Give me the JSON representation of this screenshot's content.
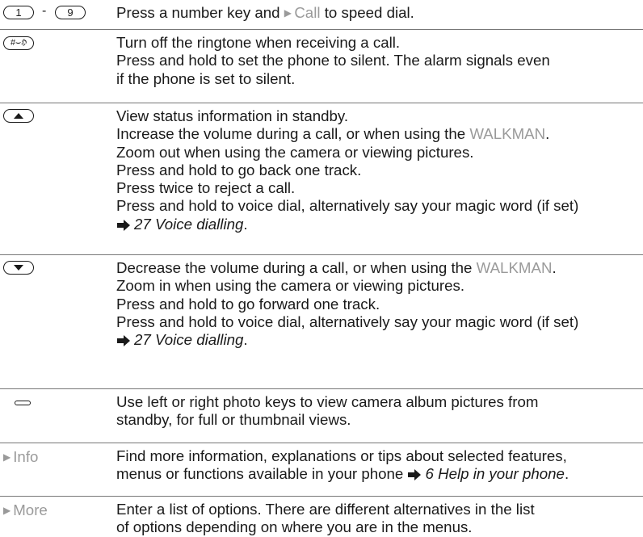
{
  "rows": [
    {
      "key": {
        "from": "1",
        "separator": "-",
        "to": "9"
      },
      "lines": [
        {
          "pre": "Press a number key and ",
          "link": "Call",
          "post": " to speed dial."
        }
      ]
    },
    {
      "key": {
        "label": "#⌣ℌ"
      },
      "lines": [
        "Turn off the ringtone when receiving a call.",
        "Press and hold to set the phone to silent. The alarm signals even",
        "if the phone is set to silent."
      ]
    },
    {
      "key": {
        "icon": "up-arrow-icon"
      },
      "lines": [
        "View status information in standby.",
        {
          "pre": "Increase the volume during a call, or when using the ",
          "brand": "WALKMAN",
          "post": "."
        },
        "Zoom out when using the camera or viewing pictures.",
        "Press and hold to go back one track.",
        "Press twice to reject a call.",
        "Press and hold to voice dial, alternatively say your magic word (if set)",
        {
          "ref": "27 Voice dialling",
          "post": "."
        }
      ]
    },
    {
      "key": {
        "icon": "down-arrow-icon"
      },
      "lines": [
        {
          "pre": "Decrease the volume during a call, or when using the ",
          "brand": "WALKMAN",
          "post": "."
        },
        "Zoom in when using the camera or viewing pictures.",
        "Press and hold to go forward one track.",
        "Press and hold to voice dial, alternatively say your magic word (if set)",
        {
          "ref": "27 Voice dialling",
          "post": "."
        }
      ]
    },
    {
      "key": {
        "icon": "photo-key-icon"
      },
      "lines": [
        "Use left or right photo keys to view camera album pictures from",
        "standby, for full or thumbnail views."
      ]
    },
    {
      "key": {
        "softkey": "Info"
      },
      "lines": [
        "Find more information, explanations or tips about selected features,",
        {
          "pre": "menus or functions available in your phone ",
          "ref": "6 Help in your phone",
          "post": "."
        }
      ]
    },
    {
      "key": {
        "softkey": "More"
      },
      "lines": [
        "Enter a list of options. There are different alternatives in the list",
        "of options depending on where you are in the menus."
      ]
    }
  ],
  "colors": {
    "text": "#1a1a1a",
    "accent_gray": "#9a9a9a",
    "rule": "#777777"
  }
}
